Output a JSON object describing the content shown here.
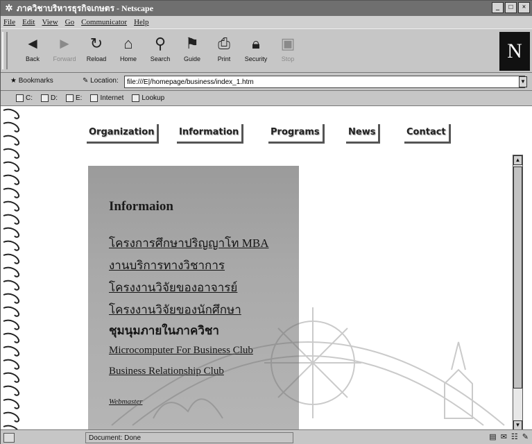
{
  "window": {
    "title": "ภาควิชาบริหารธุรกิจเกษตร - Netscape",
    "controls": [
      "_",
      "□",
      "×"
    ]
  },
  "menubar": [
    "File",
    "Edit",
    "View",
    "Go",
    "Communicator",
    "Help"
  ],
  "navigation_toolbar": [
    {
      "label": "Back",
      "icon": "back-arrow-icon",
      "enabled": true
    },
    {
      "label": "Forward",
      "icon": "forward-arrow-icon",
      "enabled": false
    },
    {
      "label": "Reload",
      "icon": "reload-icon",
      "enabled": true
    },
    {
      "label": "Home",
      "icon": "home-icon",
      "enabled": true
    },
    {
      "label": "Search",
      "icon": "search-icon",
      "enabled": true
    },
    {
      "label": "Guide",
      "icon": "guide-icon",
      "enabled": true
    },
    {
      "label": "Print",
      "icon": "print-icon",
      "enabled": true
    },
    {
      "label": "Security",
      "icon": "security-lock-icon",
      "enabled": true
    },
    {
      "label": "Stop",
      "icon": "stop-icon",
      "enabled": false
    }
  ],
  "brand_logo": "N",
  "location_bar": {
    "bookmarks_label": "Bookmarks",
    "location_label": "Location:",
    "url": "file:///E|/homepage/business/index_1.htm"
  },
  "personal_toolbar": [
    "C:",
    "D:",
    "E:",
    "Internet",
    "Lookup"
  ],
  "page": {
    "top_nav": [
      "Organization",
      "Information",
      "Programs",
      "News",
      "Contact"
    ],
    "panel": {
      "heading": "Informaion",
      "links": [
        "โครงการศึกษาปริญญาโท MBA",
        "งานบริการทางวิชาการ",
        "โครงงานวิจัยของอาจารย์",
        "โครงงานวิจัยของนักศึกษา",
        "ชุมนุมภายในภาควิชา",
        "Microcomputer For Business Club",
        "Business Relationship Club",
        "Webmaster"
      ]
    }
  },
  "status_bar": {
    "text": "Document: Done"
  },
  "colors": {
    "titlebar": "#6f6f6f",
    "chrome": "#c6c6c6",
    "panel": "#a9a9a9"
  }
}
